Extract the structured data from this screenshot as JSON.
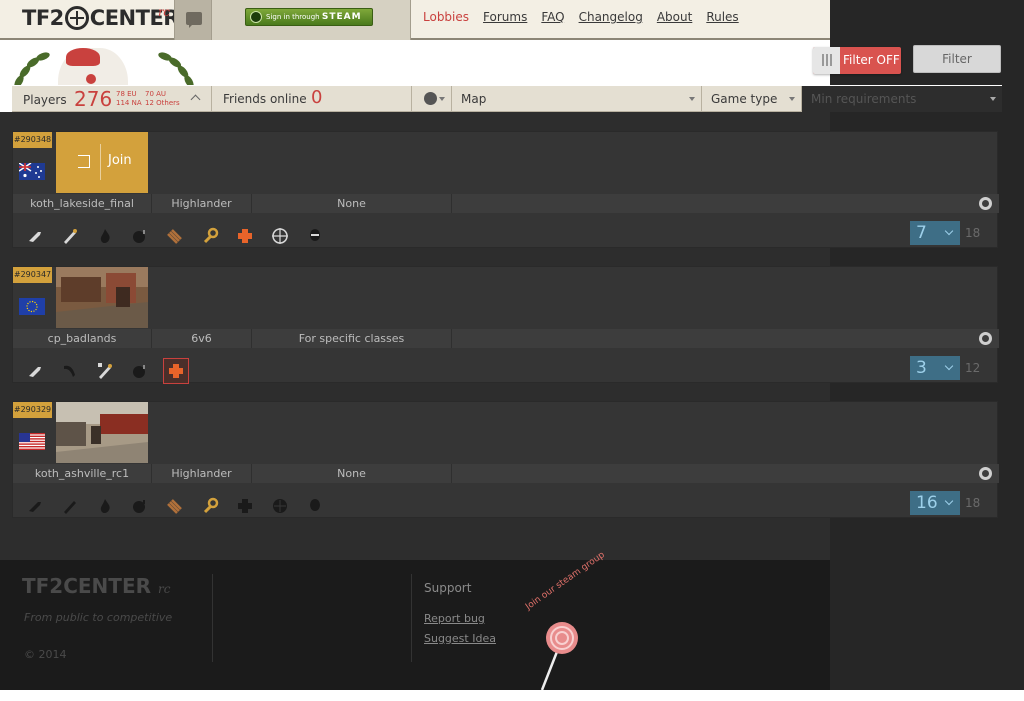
{
  "header": {
    "logo_text": "TF2CENTER",
    "logo_suffix": "rc",
    "steam_button_prefix": "Sign in through",
    "steam_button_brand": "STEAM",
    "nav": [
      {
        "label": "Lobbies",
        "active": true
      },
      {
        "label": "Forums",
        "active": false
      },
      {
        "label": "FAQ",
        "active": false
      },
      {
        "label": "Changelog",
        "active": false
      },
      {
        "label": "About",
        "active": false
      },
      {
        "label": "Rules",
        "active": false
      }
    ]
  },
  "filters": {
    "toggle_label": "Filter OFF",
    "filter_button": "Filter",
    "players_label": "Players",
    "players_total": "276",
    "players_eu": "78 EU",
    "players_au": "70 AU",
    "players_na": "114 NA",
    "players_other": "12 Others",
    "friends_label": "Friends online",
    "friends_count": "0",
    "map_label": "Map",
    "game_type_label": "Game type",
    "min_req_label": "Min requirements"
  },
  "lobbies": [
    {
      "id": "#290348",
      "flag": "australia",
      "join_label": "Join",
      "map": "koth_lakeside_final",
      "game_type": "Highlander",
      "restriction": "None",
      "slots_filled": "7",
      "slots_max": "18",
      "classes": [
        "scout-icon",
        "soldier-icon",
        "pyro-icon",
        "demoman-icon",
        "heavy-icon",
        "engineer-icon",
        "medic-icon",
        "sniper-icon",
        "spy-icon"
      ]
    },
    {
      "id": "#290347",
      "flag": "european-union",
      "map": "cp_badlands",
      "game_type": "6v6",
      "restriction": "For specific classes",
      "slots_filled": "3",
      "slots_max": "12",
      "classes": [
        "scout-icon",
        "soldier-icon",
        "pocket-soldier-icon",
        "demoman-icon",
        "medic-icon"
      ]
    },
    {
      "id": "#290329",
      "flag": "usa",
      "map": "koth_ashville_rc1",
      "game_type": "Highlander",
      "restriction": "None",
      "slots_filled": "16",
      "slots_max": "18",
      "classes": [
        "scout-icon",
        "soldier-icon",
        "pyro-icon",
        "demoman-icon",
        "heavy-icon",
        "engineer-icon",
        "medic-icon",
        "sniper-icon",
        "spy-icon"
      ]
    }
  ],
  "footer": {
    "logo_text": "TF2CENTER",
    "logo_suffix": "rc",
    "tagline": "From public to competitive",
    "copyright": "© 2014",
    "support_title": "Support",
    "report_bug": "Report bug",
    "suggest_idea": "Suggest Idea",
    "steam_group": "Join our steam group"
  },
  "colors": {
    "accent_red": "#c9413e",
    "gold": "#d3a13c",
    "slot_blue": "#3e6e86",
    "steam_green": "#5e8c2a"
  }
}
